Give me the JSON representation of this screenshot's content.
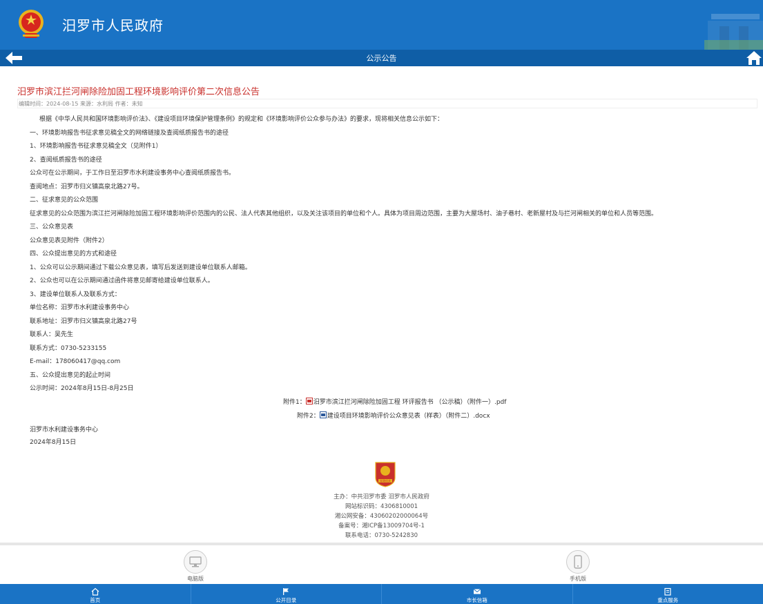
{
  "header": {
    "site_title": "汨罗市人民政府"
  },
  "nav": {
    "title": "公示公告"
  },
  "article": {
    "title": "汨罗市滨江拦河闸除险加固工程环境影响评价第二次信息公告",
    "meta": "编辑时间：2024-08-15 来源：水利局  作者：未知",
    "lines": [
      "根据《中华人民共和国环境影响评价法》、《建设项目环境保护管理条例》的规定和《环境影响评价公众参与办法》的要求，现将相关信息公示如下：",
      "一、环境影响报告书征求意见稿全文的网络链接及查阅纸质报告书的途径",
      "1、环境影响报告书征求意见稿全文（见附件1）",
      "2、查阅纸质报告书的途径",
      "公众可在公示期间，于工作日至汨罗市水利建设事务中心查阅纸质报告书。",
      "查阅地点：汨罗市归义镇高泉北路27号。",
      "二、征求意见的公众范围",
      "征求意见的公众范围为滨江拦河闸除险加固工程环境影响评价范围内的公民、法人代表其他组织，以及关注该项目的单位和个人。具体为项目周边范围，主要为大屋场村、油子巷村、老新屋村及与拦河闸相关的单位和人员等范围。",
      "三、公众意见表",
      "公众意见表见附件（附件2）",
      "四、公众提出意见的方式和途径",
      "1、公众可以公示期间通过下载公众意见表，填写后发送到建设单位联系人邮箱。",
      "2、公众也可以在公示期间通过函件将意见邮寄给建设单位联系人。",
      "3、建设单位联系人及联系方式：",
      "单位名称：汨罗市水利建设事务中心",
      "联系地址：汨罗市归义镇高泉北路27号",
      "联系人：吴先生",
      "联系方式：0730-5233155",
      "E-mail：178060417@qq.com",
      "五、公众提出意见的起止时间",
      "公示时间：2024年8月15日-8月25日"
    ],
    "attachments": [
      {
        "prefix": "附件1：",
        "name": "汨罗市滨江拦河闸除险加固工程 环评报告书 （公示稿）（附件一）.pdf",
        "icon": "pdf-file-icon"
      },
      {
        "prefix": "附件2：",
        "name": "建设项目环境影响评价公众意见表（样表）（附件二）.docx",
        "icon": "word-file-icon"
      }
    ],
    "signature": {
      "org": "汨罗市水利建设事务中心",
      "date": "2024年8月15日"
    }
  },
  "footer": {
    "badge_text": "党政机关",
    "lines": [
      "主办：中共汨罗市委  汨罗市人民政府",
      "网站标识码：4306810001",
      "湘公网安备：43060202000064号",
      "备案号：湘ICP备13009704号-1",
      "联系电话：0730-5242830"
    ]
  },
  "devices": {
    "pc": "电脑版",
    "mobile": "手机版"
  },
  "tabs": [
    {
      "label": "首页",
      "icon": "home-icon"
    },
    {
      "label": "公开目录",
      "icon": "flag-icon"
    },
    {
      "label": "市长信箱",
      "icon": "mail-icon"
    },
    {
      "label": "重点服务",
      "icon": "clipboard-icon"
    }
  ],
  "colors": {
    "primary": "#1a73c5",
    "nav": "#0f5ea6",
    "title": "#c9302c"
  }
}
